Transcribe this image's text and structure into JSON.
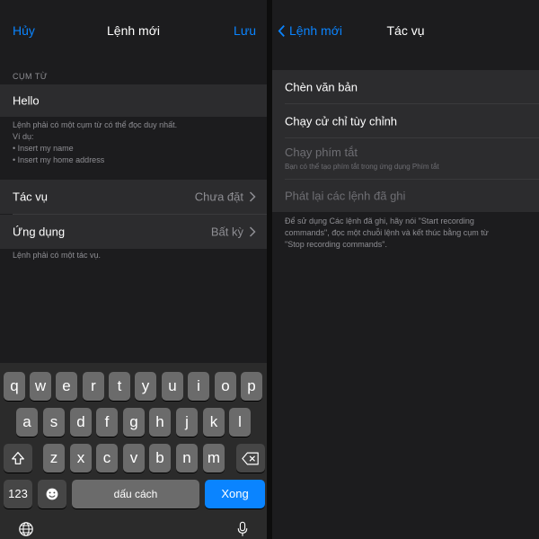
{
  "left": {
    "nav": {
      "cancel": "Hủy",
      "title": "Lệnh mới",
      "save": "Lưu"
    },
    "phrase_header": "CỤM TỪ",
    "phrase_value": "Hello",
    "phrase_help": [
      "Lệnh phải có một cụm từ có thể đọc duy nhất.",
      "Ví dụ:",
      "• Insert my name",
      "• Insert my home address"
    ],
    "action_row": {
      "label": "Tác vụ",
      "value": "Chưa đặt"
    },
    "app_row": {
      "label": "Ứng dụng",
      "value": "Bất kỳ"
    },
    "action_help": "Lệnh phải có một tác vụ."
  },
  "right": {
    "nav": {
      "back": "Lệnh mới",
      "title": "Tác vụ"
    },
    "items": [
      {
        "label": "Chèn văn bản",
        "enabled": true
      },
      {
        "label": "Chạy cử chỉ tùy chỉnh",
        "enabled": true
      },
      {
        "label": "Chạy phím tắt",
        "enabled": false,
        "subtitle": "Bạn có thể tạo phím tắt trong ứng dụng Phím tắt"
      },
      {
        "label": "Phát lại các lệnh đã ghi",
        "enabled": false
      }
    ],
    "footnote": [
      "Để sử dụng Các lệnh đã ghi, hãy nói \"Start recording",
      "commands\", đọc một chuỗi lệnh và kết thúc bằng cụm từ",
      "\"Stop recording commands\"."
    ]
  },
  "keyboard": {
    "row1": [
      "q",
      "w",
      "e",
      "r",
      "t",
      "y",
      "u",
      "i",
      "o",
      "p"
    ],
    "row2": [
      "a",
      "s",
      "d",
      "f",
      "g",
      "h",
      "j",
      "k",
      "l"
    ],
    "row3": [
      "z",
      "x",
      "c",
      "v",
      "b",
      "n",
      "m"
    ],
    "numbers_key": "123",
    "space_key": "dấu cách",
    "done_key": "Xong"
  },
  "colors": {
    "accent": "#0a84ff",
    "background": "#1c1c1e",
    "cell": "#2c2c2e",
    "secondary_text": "#8e8e93"
  }
}
